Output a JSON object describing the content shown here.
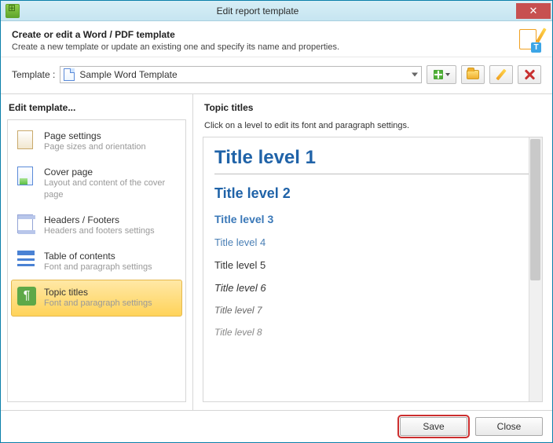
{
  "window": {
    "title": "Edit report template"
  },
  "header": {
    "heading": "Create or edit a Word / PDF template",
    "description": "Create a new template or update an existing one and specify its name and properties."
  },
  "template": {
    "label": "Template :",
    "selected": "Sample Word Template"
  },
  "sidebar": {
    "heading": "Edit template...",
    "items": [
      {
        "title": "Page settings",
        "subtitle": "Page sizes and orientation"
      },
      {
        "title": "Cover page",
        "subtitle": "Layout and content of the cover page"
      },
      {
        "title": "Headers / Footers",
        "subtitle": "Headers and footers settings"
      },
      {
        "title": "Table of contents",
        "subtitle": "Font and paragraph settings"
      },
      {
        "title": "Topic titles",
        "subtitle": "Font and paragraph settings"
      }
    ],
    "active_index": 4
  },
  "main": {
    "heading": "Topic titles",
    "hint": "Click on a level to edit its font and paragraph settings.",
    "levels": [
      "Title level 1",
      "Title level 2",
      "Title level 3",
      "Title level 4",
      "Title level 5",
      "Title level 6",
      "Title level 7",
      "Title level 8"
    ]
  },
  "footer": {
    "save": "Save",
    "close": "Close"
  }
}
